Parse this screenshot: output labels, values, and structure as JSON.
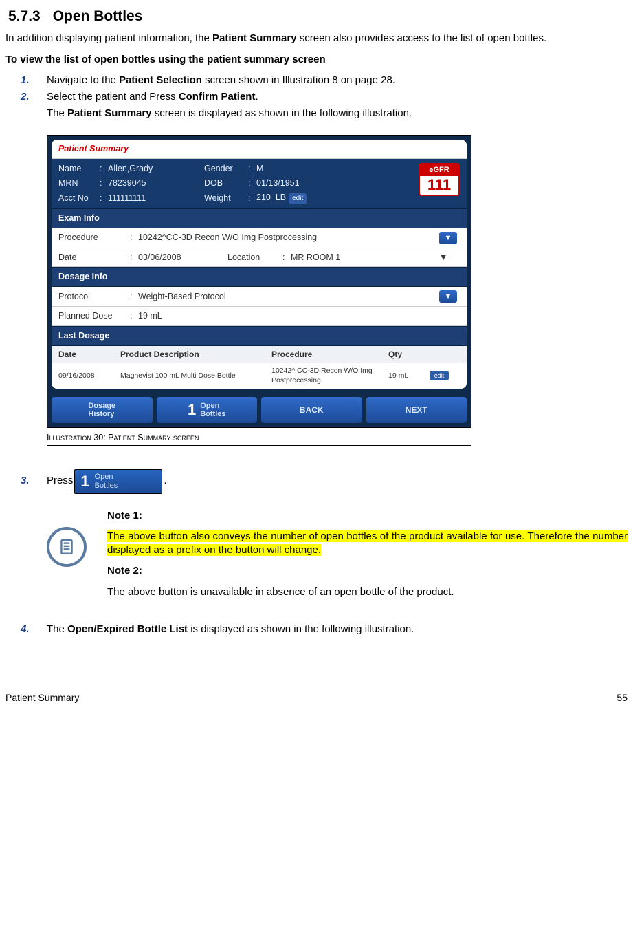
{
  "heading": {
    "num": "5.7.3",
    "title": "Open Bottles"
  },
  "intro_a": "In addition displaying patient information, the ",
  "intro_b": "Patient Summary",
  "intro_c": " screen also provides access to the list of open bottles.",
  "sub_heading": "To view the list of open bottles using the patient summary screen",
  "step1": {
    "num": "1.",
    "a": "Navigate to the ",
    "b": "Patient Selection",
    "c": " screen shown in Illustration 8 on page 28."
  },
  "step2": {
    "num": "2.",
    "a": "Select the patient and Press ",
    "b": "Confirm Patient",
    "c": "."
  },
  "step2_sub_a": "The ",
  "step2_sub_b": "Patient Summary",
  "step2_sub_c": " screen is displayed as shown in the following illustration.",
  "shot": {
    "title": "Patient Summary",
    "name_l": "Name",
    "name_v": "Allen,Grady",
    "mrn_l": "MRN",
    "mrn_v": "78239045",
    "acct_l": "Acct No",
    "acct_v": "111111111",
    "gender_l": "Gender",
    "gender_v": "M",
    "dob_l": "DOB",
    "dob_v": "01/13/1951",
    "weight_l": "Weight",
    "weight_v": "210",
    "weight_u": "LB",
    "egfr_l": "eGFR",
    "egfr_v": "111",
    "exam_h": "Exam Info",
    "proc_l": "Procedure",
    "proc_v": "10242^CC-3D Recon W/O Img Postprocessing",
    "date_l": "Date",
    "date_v": "03/06/2008",
    "loc_l": "Location",
    "loc_v": "MR ROOM 1",
    "dosage_h": "Dosage Info",
    "proto_l": "Protocol",
    "proto_v": "Weight-Based Protocol",
    "plan_l": "Planned Dose",
    "plan_v": "19 mL",
    "last_h": "Last Dosage",
    "th_date": "Date",
    "th_desc": "Product Description",
    "th_proc": "Procedure",
    "th_qty": "Qty",
    "td_date": "09/16/2008",
    "td_desc": "Magnevist 100 mL Multi Dose Bottle",
    "td_proc": "10242^ CC-3D Recon W/O Img Postprocessing",
    "td_qty": "19 mL",
    "btn_dh1": "Dosage",
    "btn_dh2": "History",
    "btn_ob_num": "1",
    "btn_ob1": "Open",
    "btn_ob2": "Bottles",
    "btn_back": "BACK",
    "btn_next": "NEXT",
    "edit": "edit"
  },
  "caption_a": "Illustration 30: Patient Summary screen",
  "step3": {
    "num": "3.",
    "a": "Press ",
    "period": "."
  },
  "ob_btn_num": "1",
  "ob_btn_l1": "Open",
  "ob_btn_l2": "Bottles",
  "note1_h": "Note 1:",
  "note1": "The above button also conveys the number of open bottles of the product available for use. Therefore the number displayed as a prefix on the button will change.",
  "note2_h": "Note 2:",
  "note2": "The above button is unavailable in absence of an open bottle of the product.",
  "step4": {
    "num": "4.",
    "a": "The ",
    "b": "Open/Expired Bottle List",
    "c": " is displayed as shown in the following illustration."
  },
  "footer_left": "Patient Summary",
  "footer_right": "55"
}
